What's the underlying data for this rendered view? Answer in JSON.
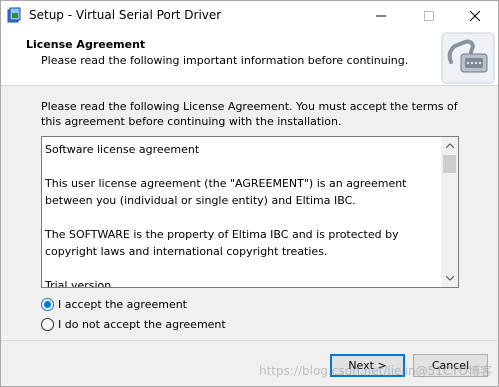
{
  "window": {
    "title": "Setup - Virtual Serial Port Driver",
    "controls": {
      "minimize": "—",
      "maximize": "☐",
      "close": "✕"
    }
  },
  "header": {
    "title": "License Agreement",
    "subtitle": "Please read the following important information before continuing."
  },
  "intro_text": "Please read the following License Agreement. You must accept the terms of this agreement before continuing with the installation.",
  "license": {
    "paragraphs": [
      "Software license agreement",
      "This user license agreement (the \"AGREEMENT\") is an agreement between you (individual or single entity) and Eltima IBC.",
      "The SOFTWARE is the property of Eltima IBC and is protected by copyright laws and international copyright treaties.",
      "Trial version"
    ]
  },
  "options": {
    "accept": {
      "label": "I accept the agreement",
      "selected": true
    },
    "decline": {
      "label": "I do not accept the agreement",
      "selected": false
    }
  },
  "buttons": {
    "next": "Next >",
    "cancel": "Cancel"
  },
  "watermark": "https://blog.csdn.net/jiejin@51CTO博客",
  "colors": {
    "accent": "#0078d7",
    "background": "#f0f0f0"
  }
}
